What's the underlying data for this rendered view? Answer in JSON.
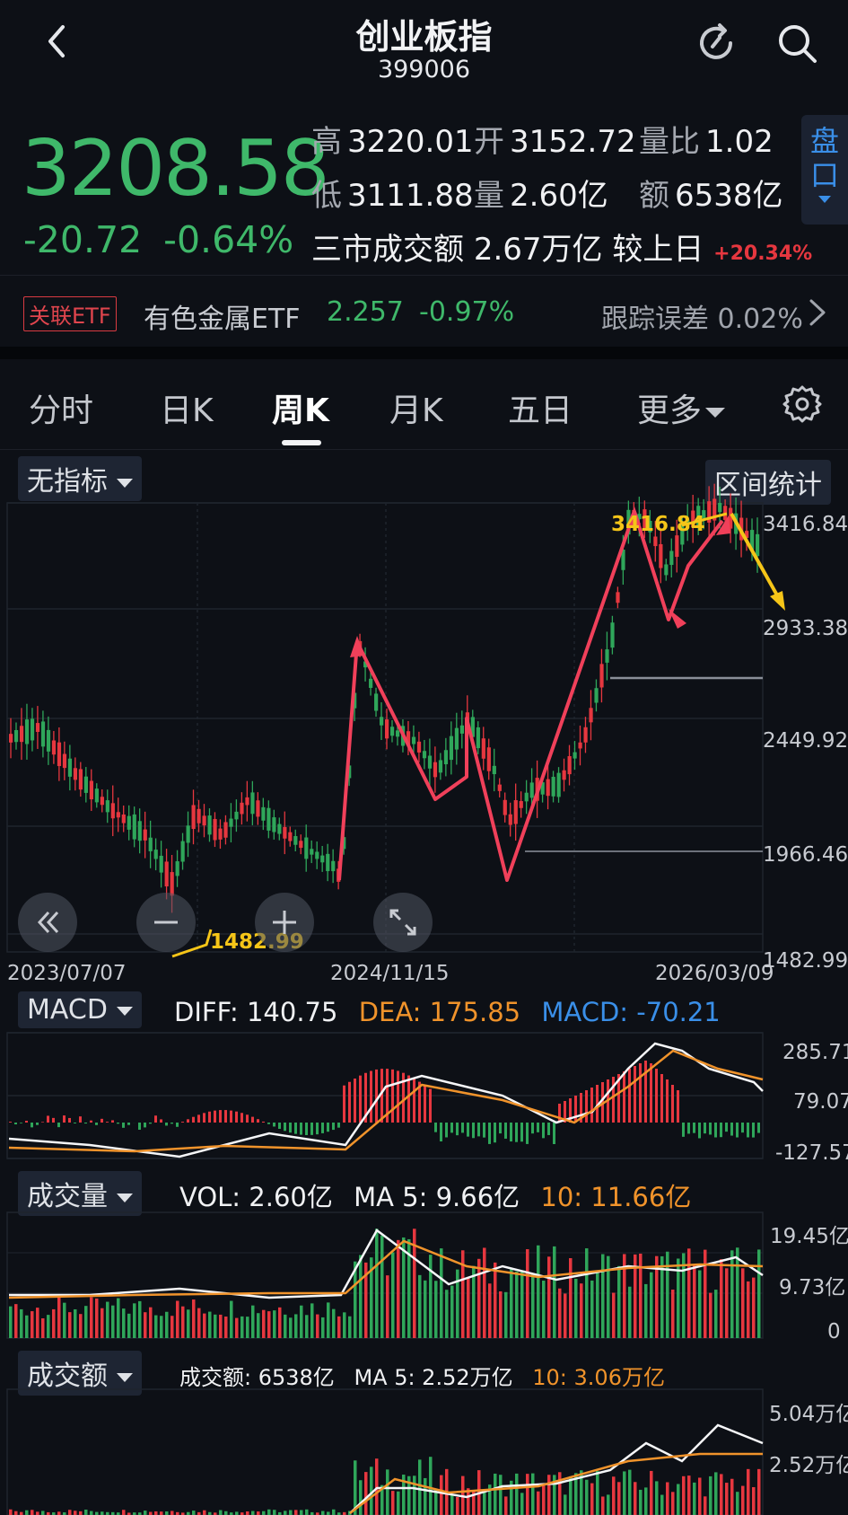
{
  "header": {
    "title": "创业板指",
    "code": "399006"
  },
  "quote": {
    "price": "3208.58",
    "change": "-20.72",
    "change_pct": "-0.64%",
    "stats": [
      {
        "key": "高",
        "value": "3220.01"
      },
      {
        "key": "开",
        "value": "3152.72"
      },
      {
        "key": "量比",
        "value": "1.02"
      },
      {
        "key": "低",
        "value": "3111.88"
      },
      {
        "key": "量",
        "value": "2.60亿"
      },
      {
        "key": "额",
        "value": "6538亿"
      }
    ],
    "turnover_label": "三市成交额",
    "turnover_value": "2.67万亿",
    "vs_prev_label": "较上日",
    "vs_prev_value": "+20.34%",
    "side_tab": "盘口"
  },
  "etf": {
    "badge": "关联ETF",
    "name": "有色金属ETF",
    "price": "2.257",
    "change_pct": "-0.97%",
    "tracking": "跟踪误差 0.02%"
  },
  "tabs": [
    {
      "label": "分时",
      "active": false
    },
    {
      "label": "日K",
      "active": false
    },
    {
      "label": "周K",
      "active": true
    },
    {
      "label": "月K",
      "active": false
    },
    {
      "label": "五日",
      "active": false
    },
    {
      "label": "更多",
      "active": false
    }
  ],
  "main_chart": {
    "indicator_select": "无指标",
    "range_stats_button": "区间统计",
    "y_ticks": [
      "3416.84",
      "2933.38",
      "2449.92",
      "1966.46",
      "1482.99"
    ],
    "x_ticks": [
      "2023/07/07",
      "2024/11/15",
      "2026/03/09"
    ],
    "max_label": "3416.84",
    "min_label": "1482.99"
  },
  "macd": {
    "select": "MACD",
    "diff": "DIFF: 140.75",
    "dea": "DEA: 175.85",
    "macd": "MACD: -70.21",
    "y_ticks": [
      "285.71",
      "79.07",
      "-127.57"
    ]
  },
  "volume": {
    "select": "成交量",
    "vol": "VOL: 2.60亿",
    "ma5": "MA 5: 9.66亿",
    "ma10": "10: 11.66亿",
    "y_ticks": [
      "19.45亿",
      "9.73亿",
      "0"
    ]
  },
  "amount": {
    "select": "成交额",
    "amt": "成交额: 6538亿",
    "ma5": "MA 5: 2.52万亿",
    "ma10": "10: 3.06万亿",
    "y_ticks": [
      "5.04万亿",
      "2.52万亿"
    ]
  },
  "colors": {
    "up": "#e6373f",
    "down": "#2fa65a",
    "accent_blue": "#3a8fe8",
    "dea_orange": "#f0932b",
    "annotation_red": "#f0405a",
    "annotation_yellow": "#f5c518"
  }
}
